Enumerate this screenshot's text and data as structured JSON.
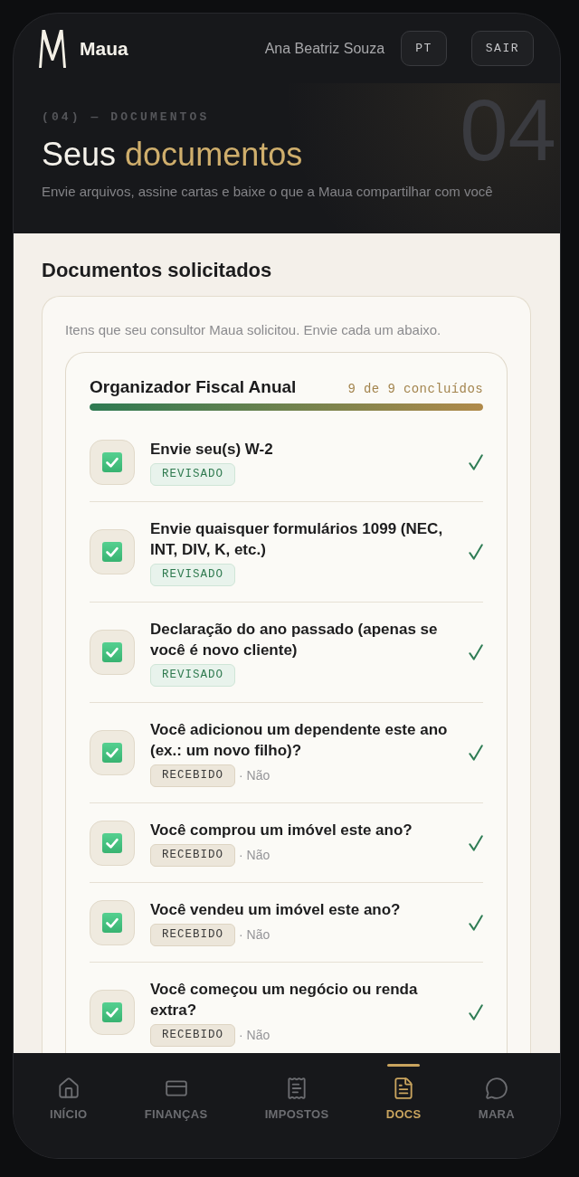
{
  "header": {
    "brand": "Maua",
    "user_name": "Ana Beatriz Souza",
    "buttons": [
      {
        "label": "PT"
      },
      {
        "label": "SAIR"
      }
    ]
  },
  "hero": {
    "eyebrow": "(04) — DOCUMENTOS",
    "title": "Seus",
    "title_accent": "documentos",
    "subtitle": "Envie arquivos, assine cartas e baixe o que a Maua compartilhar com você",
    "background_number": "04"
  },
  "section": {
    "title": "Documentos solicitados",
    "intro": "Itens que seu consultor Maua solicitou. Envie cada um abaixo.",
    "checklist": {
      "title": "Organizador Fiscal Anual",
      "progress_text": "9 de 9 concluídos",
      "level": 1,
      "items": [
        {
          "title": "Envie seu(s) W-2",
          "checked": true,
          "status": {
            "kind": "reviewed",
            "label": "REVISADO"
          }
        },
        {
          "title": "Envie quaisquer formulários 1099 (NEC, INT, DIV, K, etc.)",
          "checked": true,
          "status": {
            "kind": "reviewed",
            "label": "REVISADO"
          }
        },
        {
          "title": "Declaração do ano passado (apenas se você é novo cliente)",
          "checked": true,
          "status": {
            "kind": "reviewed",
            "label": "REVISADO"
          }
        },
        {
          "title": "Você adicionou um dependente este ano (ex.: um novo filho)?",
          "checked": true,
          "status": {
            "kind": "received",
            "label": "RECEBIDO"
          },
          "answer": "· Não"
        },
        {
          "title": "Você comprou um imóvel este ano?",
          "checked": true,
          "status": {
            "kind": "received",
            "label": "RECEBIDO"
          },
          "answer": "· Não"
        },
        {
          "title": "Você vendeu um imóvel este ano?",
          "checked": true,
          "status": {
            "kind": "received",
            "label": "RECEBIDO"
          },
          "answer": "· Não"
        },
        {
          "title": "Você começou um negócio ou renda extra?",
          "checked": true,
          "status": {
            "kind": "received",
            "label": "RECEBIDO"
          },
          "answer": "· Não"
        }
      ]
    }
  },
  "nav": {
    "items": [
      {
        "label": "INÍCIO",
        "selected": false
      },
      {
        "label": "FINANÇAS",
        "selected": false
      },
      {
        "label": "IMPOSTOS",
        "selected": false
      },
      {
        "label": "DOCS",
        "selected": true
      },
      {
        "label": "MARA",
        "selected": false
      }
    ]
  }
}
